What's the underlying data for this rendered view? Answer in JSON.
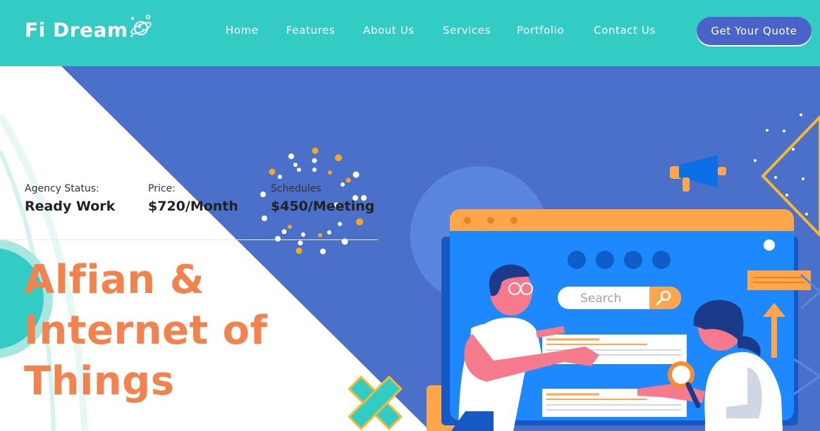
{
  "header": {
    "brand": "Fi Dream",
    "nav": [
      {
        "label": "Home"
      },
      {
        "label": "Features"
      },
      {
        "label": "About Us"
      },
      {
        "label": "Services"
      },
      {
        "label": "Portfolio"
      },
      {
        "label": "Contact Us"
      }
    ],
    "cta_label": "Get Your Quote"
  },
  "hero": {
    "stats": [
      {
        "label": "Agency Status:",
        "value": "Ready Work"
      },
      {
        "label": "Price:",
        "value": "$720/Month"
      },
      {
        "label": "Schedules",
        "value": "$450/Meeting"
      }
    ],
    "headline": [
      "Alfian &",
      "Internet of",
      "Things"
    ],
    "illustration": {
      "search_placeholder": "Search"
    }
  },
  "colors": {
    "header_bg": "#33ccc4",
    "hero_blue": "#4a70c9",
    "cta_bg": "#4a63c9",
    "headline": "#f2824e",
    "accent_orange": "#ffa64d",
    "screen_blue": "#1e88ff"
  },
  "icons": [
    "planet-stars-icon",
    "megaphone-icon",
    "magnifier-icon",
    "arrow-up-icon",
    "cross-decoration-icon"
  ]
}
